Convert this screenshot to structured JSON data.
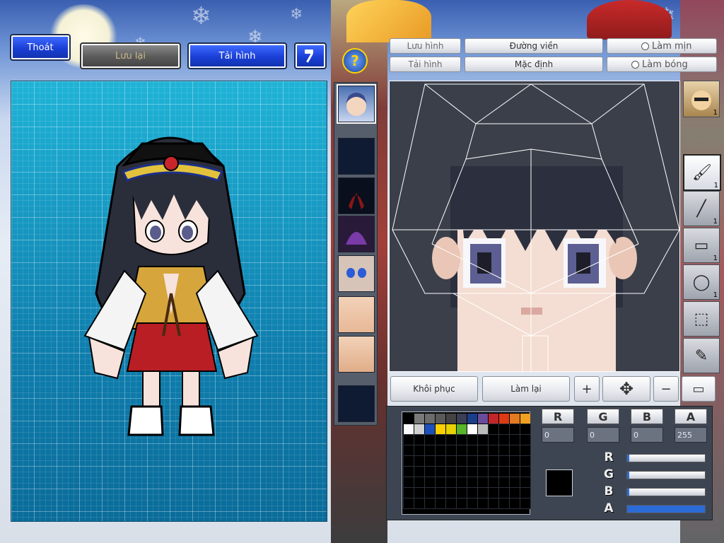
{
  "top_buttons": {
    "exit": "Thoát",
    "save": "Lưu lại",
    "reload": "Tải hình",
    "help_symbol": "?"
  },
  "editor_buttons": {
    "save_image": "Lưu hình",
    "load_image": "Tải hình",
    "outline": "Đường viền",
    "default": "Mặc định"
  },
  "options": {
    "smooth": "Làm mịn",
    "shade": "Làm bóng"
  },
  "parts_panel": {
    "items": [
      "face-portrait",
      "empty-slot",
      "hair-red",
      "hat-purple",
      "face-blue-eyes",
      "body-skin",
      "neck-skin",
      "empty-slot"
    ]
  },
  "tools": [
    {
      "name": "brush",
      "count": "1"
    },
    {
      "name": "line",
      "count": "1"
    },
    {
      "name": "rectangle",
      "count": "1"
    },
    {
      "name": "ellipse",
      "count": "1"
    },
    {
      "name": "selection",
      "count": ""
    },
    {
      "name": "eyedropper",
      "count": ""
    }
  ],
  "tool_top_badge": "1",
  "bottom_bar": {
    "restore": "Khôi phục",
    "redo": "Làm lại",
    "plus": "+",
    "move": "✥",
    "minus": "−",
    "window": "▭"
  },
  "color": {
    "r_label": "R",
    "g_label": "G",
    "b_label": "B",
    "a_label": "A",
    "r_value": "0",
    "g_value": "0",
    "b_value": "0",
    "a_value": "255",
    "current": "#000000",
    "sliders": {
      "r": 0,
      "g": 0,
      "b": 0,
      "a": 1.0
    }
  },
  "palette_colors": [
    "#000000",
    "#7a7a7a",
    "#6c6c6c",
    "#5a5a5a",
    "#444444",
    "#3a3f53",
    "#1b3e8a",
    "#6a4c9c",
    "#c1262b",
    "#dd3a14",
    "#e27a20",
    "#f0a020",
    "#fafafa",
    "#d0d0d0",
    "#1e4fbf",
    "#ffd000",
    "#e6d200",
    "#58b428",
    "#ffffff",
    "#bbbbbb"
  ]
}
